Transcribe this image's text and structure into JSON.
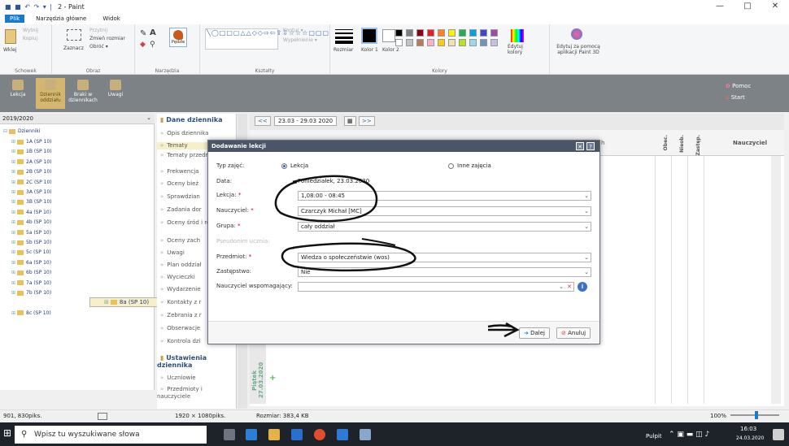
{
  "window": {
    "quick_access": "■ ■ ↶ ↷ ▾ |",
    "title": "2 - Paint",
    "minimize": "—",
    "maximize": "□",
    "close": "✕"
  },
  "ribbon_tabs": [
    "Plik",
    "Narzędzia główne",
    "Widok"
  ],
  "ribbon": {
    "groups": [
      "Schowek",
      "Obraz",
      "Narzędzia",
      "Kształty",
      "Kolory"
    ],
    "clipboard": {
      "paste": "Wklej",
      "cut": "Wytnij",
      "copy": "Kopiuj"
    },
    "image": {
      "select": "Zaznacz",
      "crop": "Przytnij",
      "resize": "Zmień rozmiar",
      "rotate": "Obróć ▾"
    },
    "brushes": "Pędzle",
    "shapes": {
      "outline": "Kontur ▾",
      "fill": "Wypełnienie ▾"
    },
    "size": "Rozmiar",
    "color1": "Kolor 1",
    "color2": "Kolor 2",
    "edit_colors": "Edytuj kolory",
    "paint3d": "Edytuj za pomocą aplikacji Paint 3D",
    "palette_row1": [
      "#000000",
      "#7f7f7f",
      "#880015",
      "#ed1c24",
      "#ff7f27",
      "#fff200",
      "#22b14c",
      "#00a2e8",
      "#3f48cc",
      "#a349a4"
    ],
    "palette_row2": [
      "#ffffff",
      "#c3c3c3",
      "#b97a57",
      "#ffaec9",
      "#ffc90e",
      "#efe4b0",
      "#b5e61d",
      "#99d9ea",
      "#7092be",
      "#c8bfe7"
    ]
  },
  "app_toolbar": {
    "items": [
      "Lekcja",
      "Dziennik oddziału",
      "Braki w dziennikach",
      "Uwagi"
    ],
    "help": "Pomoc",
    "start": "Start"
  },
  "tree": {
    "year": "2019/2020",
    "root": "Dzienniki",
    "classes": [
      "1A (SP 10)",
      "1B (SP 10)",
      "2A (SP 10)",
      "2B (SP 10)",
      "2C (SP 10)",
      "3A (SP 10)",
      "3B (SP 10)",
      "4a (SP 10)",
      "4b (SP 10)",
      "5a (SP 10)",
      "5b (SP 10)",
      "5c (SP 10)",
      "6a (SP 10)",
      "6b (SP 10)",
      "7a (SP 10)",
      "7b (SP 10)",
      "8a (SP 10)",
      "8c (SP 10)"
    ],
    "selected_index": 16
  },
  "menu": {
    "header": "Dane dziennika",
    "items": [
      "Opis dziennika",
      "Tematy",
      "Tematy przedmiotar",
      "Frekwencja",
      "Oceny bież",
      "Sprawdzian",
      "Zadania dor",
      "Oceny śród i roczne",
      "Oceny zach",
      "Uwagi",
      "Plan oddział",
      "Wycieczki",
      "Wydarzenie",
      "Kontakty z r",
      "Zebrania z r",
      "Obserwacje",
      "Kontrola dzi"
    ],
    "header2": "Ustawienia dziennika",
    "items2": [
      "Uczniowie",
      "Przedmioty i nauczyciele"
    ]
  },
  "grid": {
    "date_range": "23.03 - 29.03 2020",
    "prev": "<<",
    "next": ">>",
    "col_partial": "h",
    "cols": [
      "Obec.",
      "Nieob.",
      "Zastęp."
    ],
    "teacher_col": "Nauczyciel",
    "day": "Piątek 27.03.2020"
  },
  "dialog": {
    "title": "Dodawanie lekcji",
    "type_label": "Typ zajęć:",
    "type_option1": "Lekcja",
    "type_option2": "Inne zajęcia",
    "date_label": "Data:",
    "date_value": "Poniedziałek, 23.03.2020",
    "lesson_label": "Lekcja:",
    "lesson_value": "1,08:00 - 08:45",
    "teacher_label": "Nauczyciel:",
    "teacher_value": "Czarczyk Michał [MC]",
    "group_label": "Grupa:",
    "group_value": "cały oddział",
    "pseudonym_label": "Pseudonim ucznia:",
    "subject_label": "Przedmiot:",
    "subject_value": "Wiedza o społeczeństwie (wos)",
    "substitution_label": "Zastępstwo:",
    "substitution_value": "Nie",
    "assistant_label": "Nauczyciel wspomagający:",
    "assistant_value": "",
    "required_mark": "*",
    "next_btn": "Dalej",
    "cancel_btn": "Anuluj",
    "close": "✕",
    "help": "?"
  },
  "status": {
    "cursor": "901, 830piks.",
    "canvas_size": "1920 × 1080piks.",
    "file_size": "Rozmiar: 383,4 KB",
    "zoom": "100%"
  },
  "taskbar": {
    "search_placeholder": "Wpisz tu wyszukiwane słowa",
    "desktop": "Pulpit",
    "time": "16:03",
    "date": "24.03.2020"
  },
  "colors": {
    "accent": "#1979ca",
    "dialog_title": "#4a5668",
    "toolbar": "#7d8286",
    "selected_row": "#f7efc8"
  }
}
